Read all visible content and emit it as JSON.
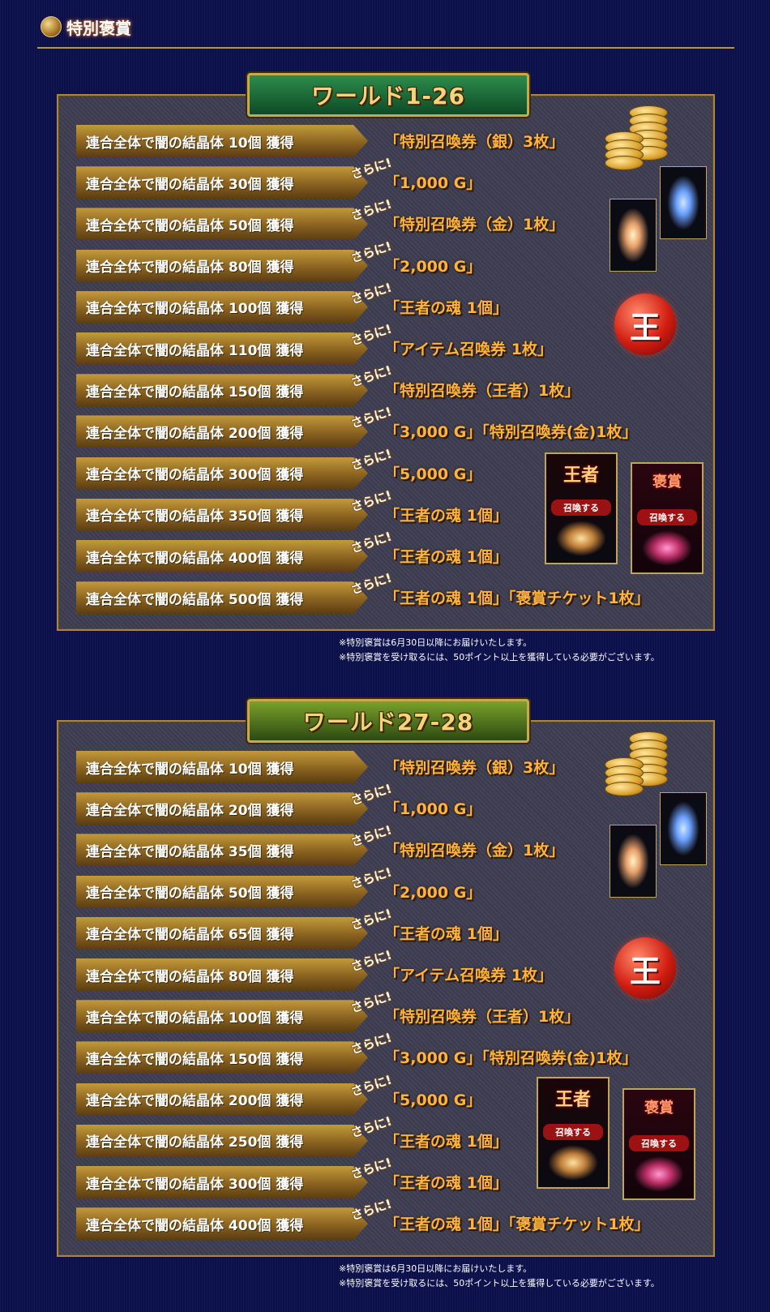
{
  "header": {
    "title": "特別褒賞",
    "icon": "medal-icon"
  },
  "sections": [
    {
      "title": "ワールド1-26",
      "rows": [
        {
          "label": "連合全体で闇の結晶体 10個 獲得",
          "sarani": "",
          "reward": "「特別召喚券（銀）3枚」"
        },
        {
          "label": "連合全体で闇の結晶体 30個 獲得",
          "sarani": "さらに!",
          "reward": "「1,000 G」"
        },
        {
          "label": "連合全体で闇の結晶体 50個 獲得",
          "sarani": "さらに!",
          "reward": "「特別召喚券（金）1枚」"
        },
        {
          "label": "連合全体で闇の結晶体 80個 獲得",
          "sarani": "さらに!",
          "reward": "「2,000 G」"
        },
        {
          "label": "連合全体で闇の結晶体 100個 獲得",
          "sarani": "さらに!",
          "reward": "「王者の魂 1個」"
        },
        {
          "label": "連合全体で闇の結晶体 110個 獲得",
          "sarani": "さらに!",
          "reward": "「アイテム召喚券  1枚」"
        },
        {
          "label": "連合全体で闇の結晶体 150個 獲得",
          "sarani": "さらに!",
          "reward": "「特別召喚券（王者）1枚」"
        },
        {
          "label": "連合全体で闇の結晶体 200個 獲得",
          "sarani": "さらに!",
          "reward": "「3,000 G」「特別召喚券(金)1枚」"
        },
        {
          "label": "連合全体で闇の結晶体 300個 獲得",
          "sarani": "さらに!",
          "reward": "「5,000 G」"
        },
        {
          "label": "連合全体で闇の結晶体 350個 獲得",
          "sarani": "さらに!",
          "reward": "「王者の魂 1個」"
        },
        {
          "label": "連合全体で闇の結晶体 400個 獲得",
          "sarani": "さらに!",
          "reward": "「王者の魂 1個」"
        },
        {
          "label": "連合全体で闇の結晶体 500個 獲得",
          "sarani": "さらに!",
          "reward": "「王者の魂 1個」「褒賞チケット1枚」"
        }
      ],
      "notes": [
        "※特別褒賞は6月30日以降にお届けいたします。",
        "※特別褒賞を受け取るには、50ポイント以上を獲得している必要がございます。"
      ]
    },
    {
      "title": "ワールド27-28",
      "rows": [
        {
          "label": "連合全体で闇の結晶体 10個 獲得",
          "sarani": "",
          "reward": "「特別召喚券（銀）3枚」"
        },
        {
          "label": "連合全体で闇の結晶体 20個 獲得",
          "sarani": "さらに!",
          "reward": "「1,000 G」"
        },
        {
          "label": "連合全体で闇の結晶体 35個 獲得",
          "sarani": "さらに!",
          "reward": "「特別召喚券（金）1枚」"
        },
        {
          "label": "連合全体で闇の結晶体 50個 獲得",
          "sarani": "さらに!",
          "reward": "「2,000 G」"
        },
        {
          "label": "連合全体で闇の結晶体 65個 獲得",
          "sarani": "さらに!",
          "reward": "「王者の魂 1個」"
        },
        {
          "label": "連合全体で闇の結晶体 80個 獲得",
          "sarani": "さらに!",
          "reward": "「アイテム召喚券  1枚」"
        },
        {
          "label": "連合全体で闇の結晶体 100個 獲得",
          "sarani": "さらに!",
          "reward": "「特別召喚券（王者）1枚」"
        },
        {
          "label": "連合全体で闇の結晶体 150個 獲得",
          "sarani": "さらに!",
          "reward": "「3,000 G」「特別召喚券(金)1枚」"
        },
        {
          "label": "連合全体で闇の結晶体 200個 獲得",
          "sarani": "さらに!",
          "reward": "「5,000 G」"
        },
        {
          "label": "連合全体で闇の結晶体 250個 獲得",
          "sarani": "さらに!",
          "reward": "「王者の魂 1個」"
        },
        {
          "label": "連合全体で闇の結晶体 300個 獲得",
          "sarani": "さらに!",
          "reward": "「王者の魂 1個」"
        },
        {
          "label": "連合全体で闇の結晶体 400個 獲得",
          "sarani": "さらに!",
          "reward": "「王者の魂 1個」「褒賞チケット1枚」"
        }
      ],
      "notes": [
        "※特別褒賞は6月30日以降にお届けいたします。",
        "※特別褒賞を受け取るには、50ポイント以上を獲得している必要がございます。"
      ]
    }
  ],
  "images": {
    "orb_char": "王",
    "card_king_title": "王者",
    "card_reward_title": "褒賞",
    "card_button": "召喚する"
  },
  "colors": {
    "background": "#0b0f4a",
    "reward_text": "#ffb23c",
    "gold_border": "#a9863a"
  }
}
